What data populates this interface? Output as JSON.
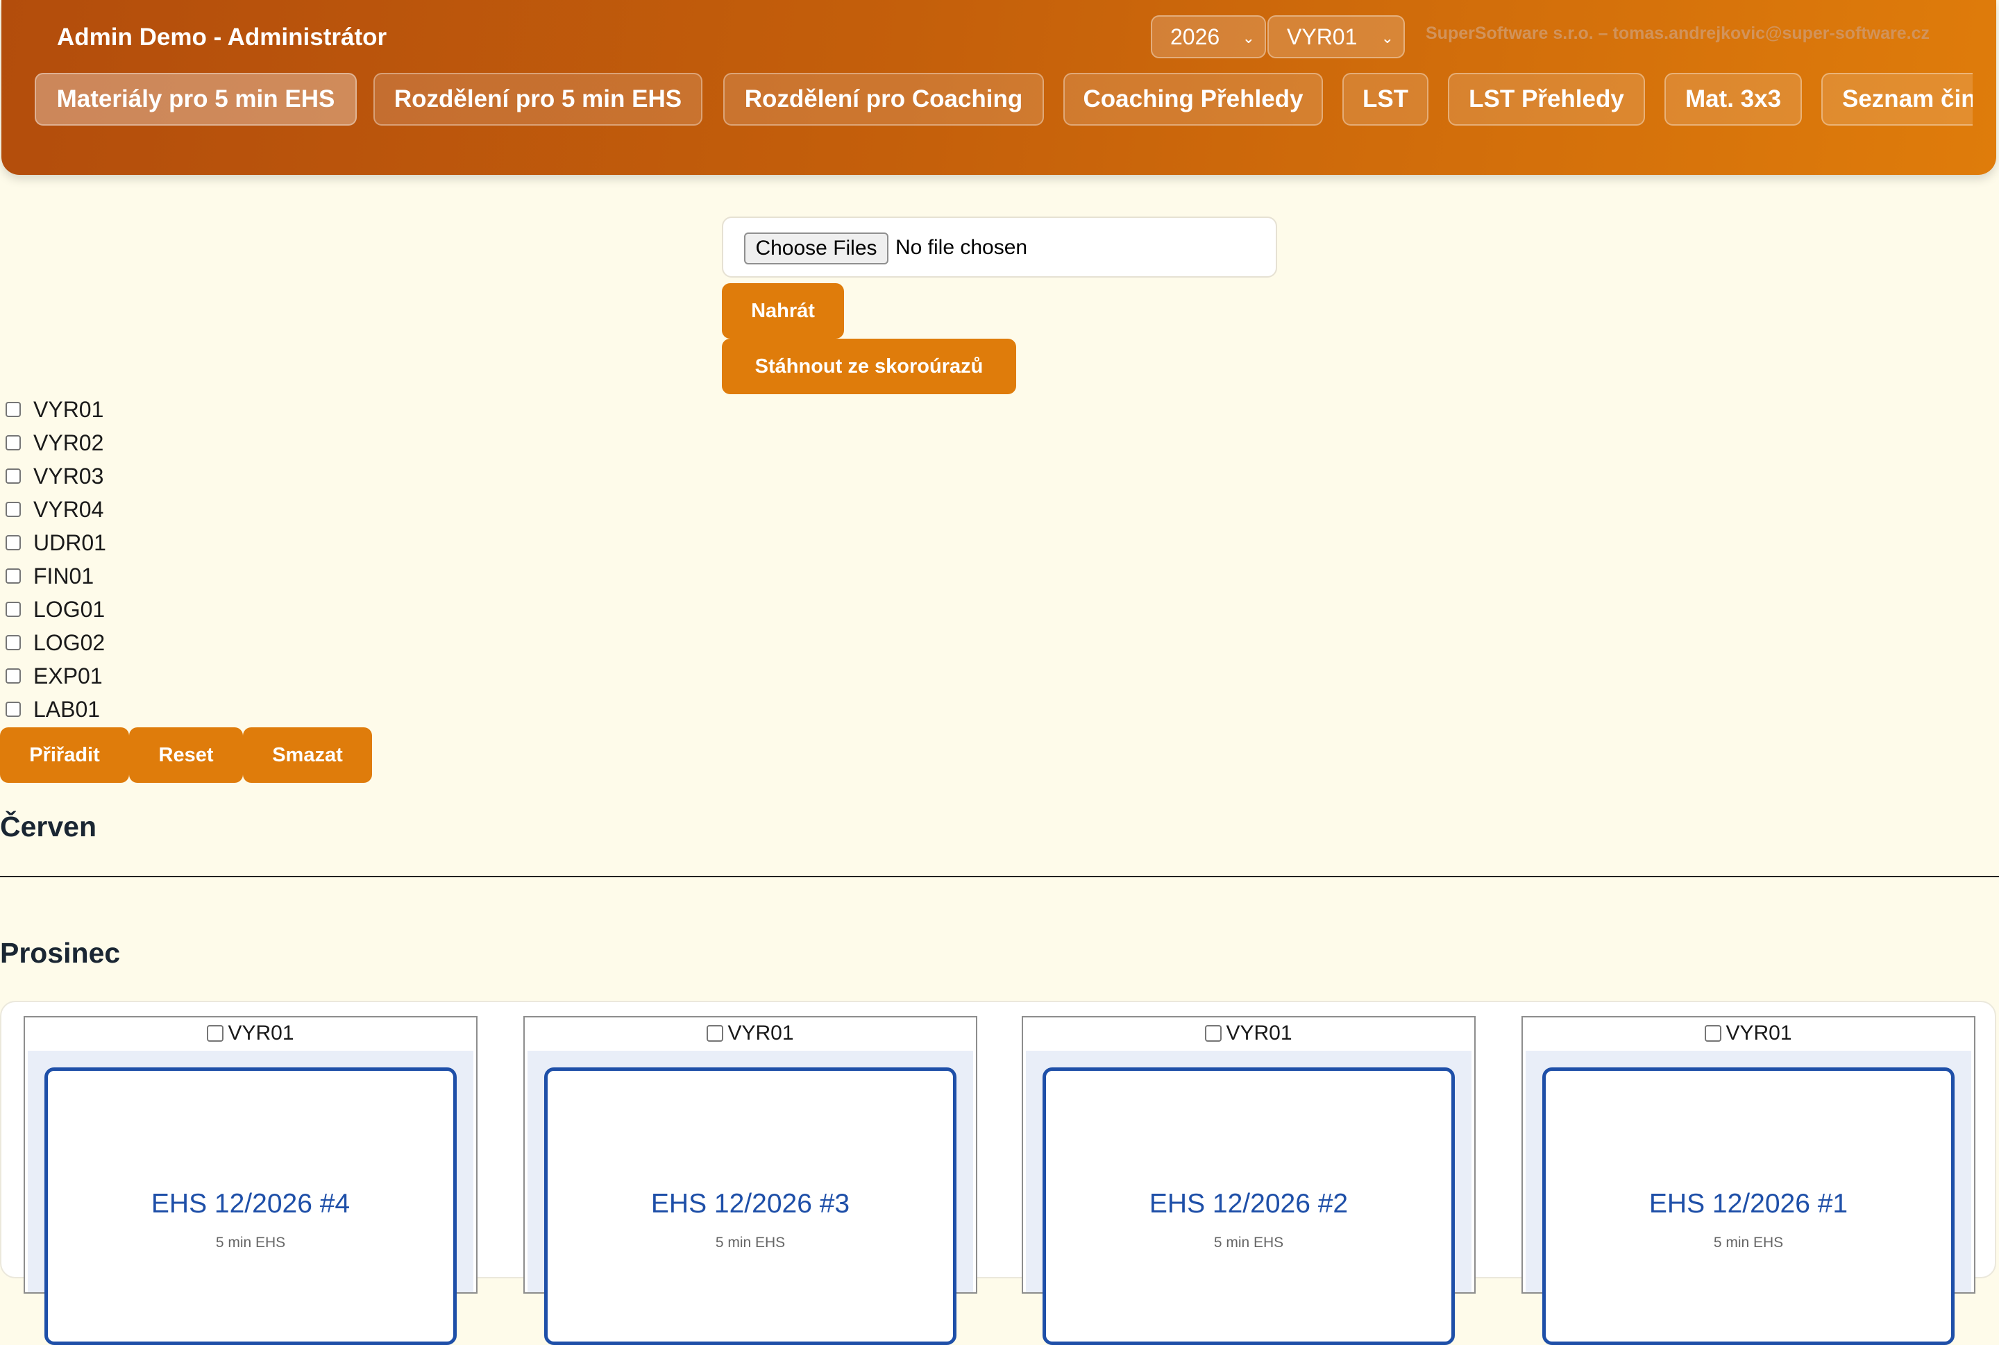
{
  "header": {
    "title": "Admin Demo - Administrátor",
    "year_select": "2026",
    "unit_select": "VYR01",
    "company": "SuperSoftware s.r.o. – tomas.andrejkovic@super-software.cz",
    "tabs": [
      "Materiály pro 5 min EHS",
      "Rozdělení pro 5 min EHS",
      "Rozdělení pro Coaching",
      "Coaching Přehledy",
      "LST",
      "LST Přehledy",
      "Mat. 3x3",
      "Seznam čin"
    ],
    "accent_color": "#df7c0b"
  },
  "upload": {
    "choose_label": "Choose Files",
    "status": "No file chosen",
    "upload_button": "Nahrát",
    "download_button": "Stáhnout ze skoroúrazů"
  },
  "units": [
    "VYR01",
    "VYR02",
    "VYR03",
    "VYR04",
    "UDR01",
    "FIN01",
    "LOG01",
    "LOG02",
    "EXP01",
    "LAB01"
  ],
  "actions": {
    "assign": "Přiřadit",
    "reset": "Reset",
    "delete": "Smazat"
  },
  "sections": [
    {
      "month": "Červen"
    },
    {
      "month": "Prosinec",
      "cards": [
        {
          "unit": "VYR01",
          "title": "EHS 12/2026 #4",
          "subtitle": "5 min EHS"
        },
        {
          "unit": "VYR01",
          "title": "EHS 12/2026 #3",
          "subtitle": "5 min EHS"
        },
        {
          "unit": "VYR01",
          "title": "EHS 12/2026 #2",
          "subtitle": "5 min EHS"
        },
        {
          "unit": "VYR01",
          "title": "EHS 12/2026 #1",
          "subtitle": "5 min EHS"
        }
      ]
    }
  ]
}
